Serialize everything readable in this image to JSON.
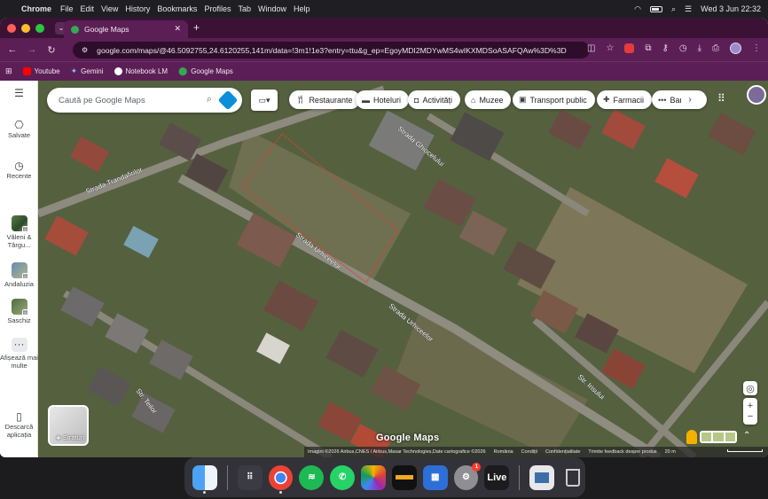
{
  "menubar": {
    "app": "Chrome",
    "items": [
      "File",
      "Edit",
      "View",
      "History",
      "Bookmarks",
      "Profiles",
      "Tab",
      "Window",
      "Help"
    ],
    "clock": "Wed 3 Jun  22:32"
  },
  "browser": {
    "tab_title": "Google Maps",
    "url": "google.com/maps/@46.5092755,24.6120255,141m/data=!3m1!1e3?entry=ttu&g_ep=EgoyMDI2MDYwMS4wIKXMDSoASAFQAw%3D%3D",
    "bookmarks": [
      {
        "label": "Youtube",
        "icon": "youtube-icon",
        "color": "#ff0000"
      },
      {
        "label": "Gemini",
        "icon": "gemini-icon",
        "color": "#8ab4f8"
      },
      {
        "label": "Notebook LM",
        "icon": "notebooklm-icon",
        "color": "#ffffff"
      },
      {
        "label": "Google Maps",
        "icon": "maps-icon",
        "color": "#34a853"
      }
    ]
  },
  "sidebar": {
    "items": [
      {
        "label": "Salvate",
        "icon": "bookmark-icon"
      },
      {
        "label": "Recente",
        "icon": "history-icon"
      },
      {
        "label": "Văleni & Târgu...",
        "icon": "saved-list-thumb"
      },
      {
        "label": "Andaluzia",
        "icon": "saved-list-thumb"
      },
      {
        "label": "Saschiz",
        "icon": "saved-list-thumb"
      },
      {
        "label": "Afișează mai multe",
        "icon": "more-icon"
      },
      {
        "label": "Descarcă aplicația",
        "icon": "phone-icon"
      }
    ]
  },
  "map": {
    "search_placeholder": "Caută pe Google Maps",
    "chips": [
      {
        "label": "Restaurante",
        "icon": "restaurant-icon"
      },
      {
        "label": "Hoteluri",
        "icon": "hotel-icon"
      },
      {
        "label": "Activități",
        "icon": "camera-icon"
      },
      {
        "label": "Muzee",
        "icon": "museum-icon"
      },
      {
        "label": "Transport public",
        "icon": "transit-icon"
      },
      {
        "label": "Farmacii",
        "icon": "pharmacy-icon"
      },
      {
        "label": "Ban",
        "icon": "more-dots-icon"
      }
    ],
    "street_labels": [
      "Strada Trandafirilor",
      "Strada Ghiocelului",
      "Strada Urhiceelor",
      "Strada Urhiceelor",
      "Str. Teilor",
      "Str. Irisului"
    ],
    "layers_label": "Straturi",
    "watermark": "Google Maps",
    "attribution": [
      "Imagini ©2026 Airbus,CNES / Airbus,Maxar Technologies,Date cartografice ©2026",
      "România",
      "Condiții",
      "Confidențialitate",
      "Trimite feedback despre produs",
      "20 m"
    ]
  },
  "dock": {
    "apps": [
      "Finder",
      "Launchpad",
      "Chrome",
      "Spotify",
      "WhatsApp",
      "Photos",
      "Wallet",
      "Calendar",
      "Settings",
      "Live",
      "Preview",
      "Trash"
    ],
    "settings_badge": "1",
    "live_label": "Live"
  }
}
